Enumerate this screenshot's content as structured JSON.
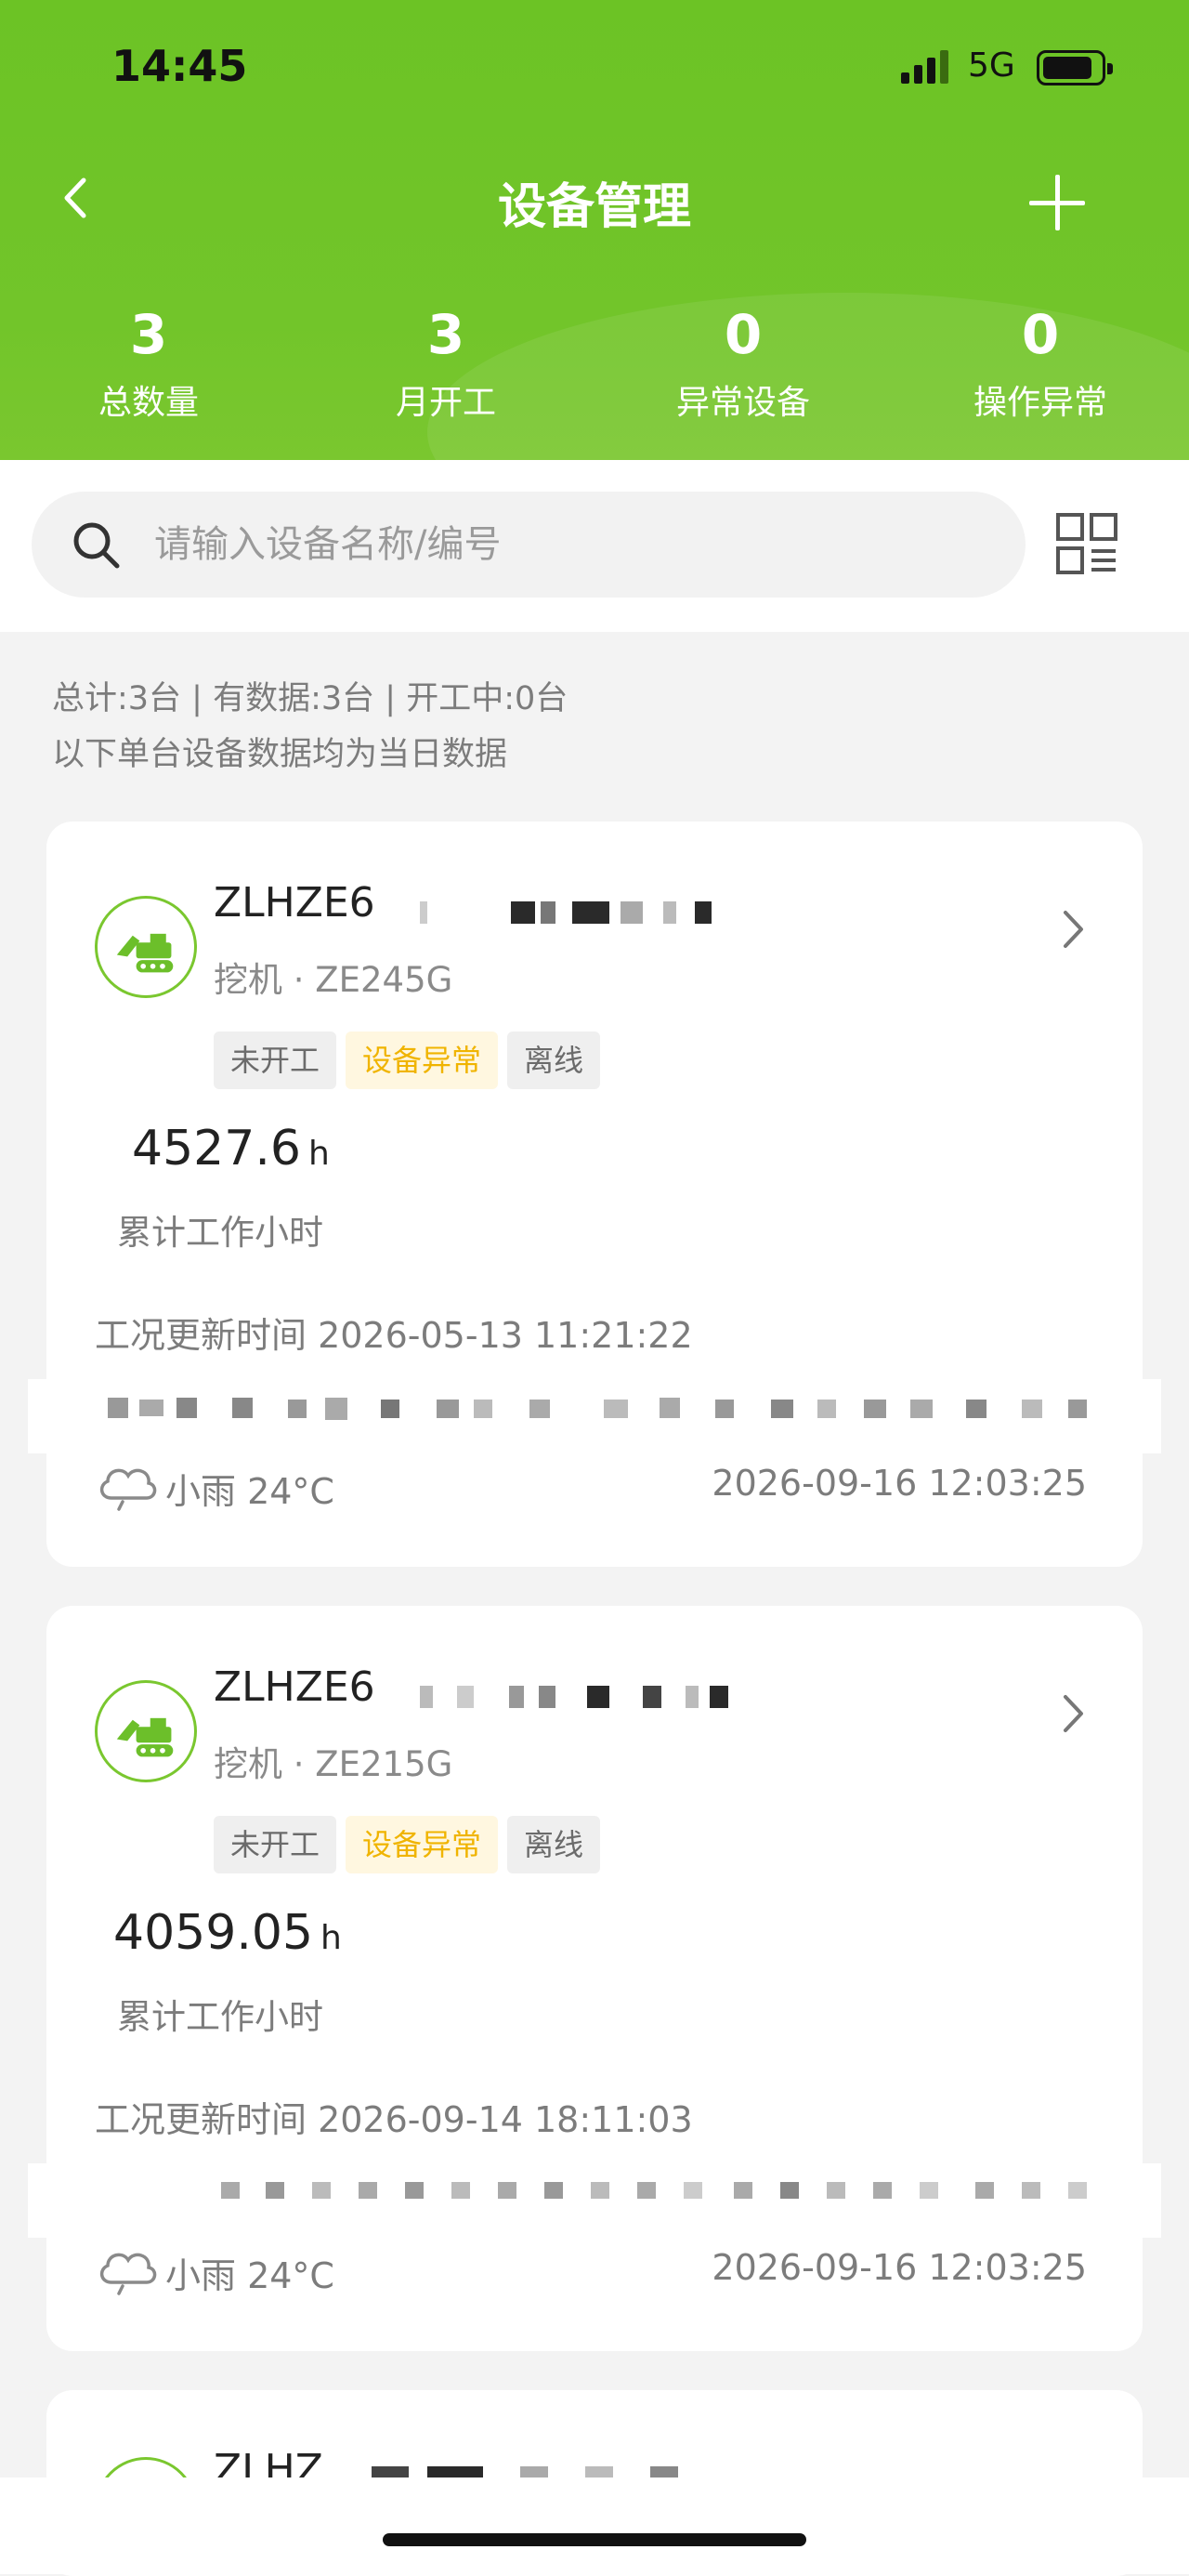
{
  "status_bar": {
    "time": "14:45",
    "network": "5G"
  },
  "header": {
    "title": "设备管理"
  },
  "stats": [
    {
      "value": "3",
      "label": "总数量"
    },
    {
      "value": "3",
      "label": "月开工"
    },
    {
      "value": "0",
      "label": "异常设备"
    },
    {
      "value": "0",
      "label": "操作异常"
    }
  ],
  "search": {
    "placeholder": "请输入设备名称/编号"
  },
  "summary": {
    "line1": "总计:3台 | 有数据:3台 | 开工中:0台",
    "line2": "以下单台设备数据均为当日数据"
  },
  "devices": [
    {
      "name": "ZLHZE6",
      "type": "挖机 · ZE245G",
      "tags": [
        "未开工",
        "设备异常",
        "离线"
      ],
      "hours": "4527.6",
      "hours_unit": "h",
      "hours_label": "累计工作小时",
      "update_time": "工况更新时间 2026-05-13 11:21:22",
      "weather": "小雨 24°C",
      "weather_time": "2026-09-16 12:03:25"
    },
    {
      "name": "ZLHZE6",
      "type": "挖机 · ZE215G",
      "tags": [
        "未开工",
        "设备异常",
        "离线"
      ],
      "hours": "4059.05",
      "hours_unit": "h",
      "hours_label": "累计工作小时",
      "update_time": "工况更新时间 2026-09-14 18:11:03",
      "weather": "小雨 24°C",
      "weather_time": "2026-09-16 12:03:25"
    },
    {
      "name": "ZLHZ"
    }
  ],
  "colors": {
    "brand_green": "#72c52a",
    "tag_yellow": "#f0b400"
  }
}
